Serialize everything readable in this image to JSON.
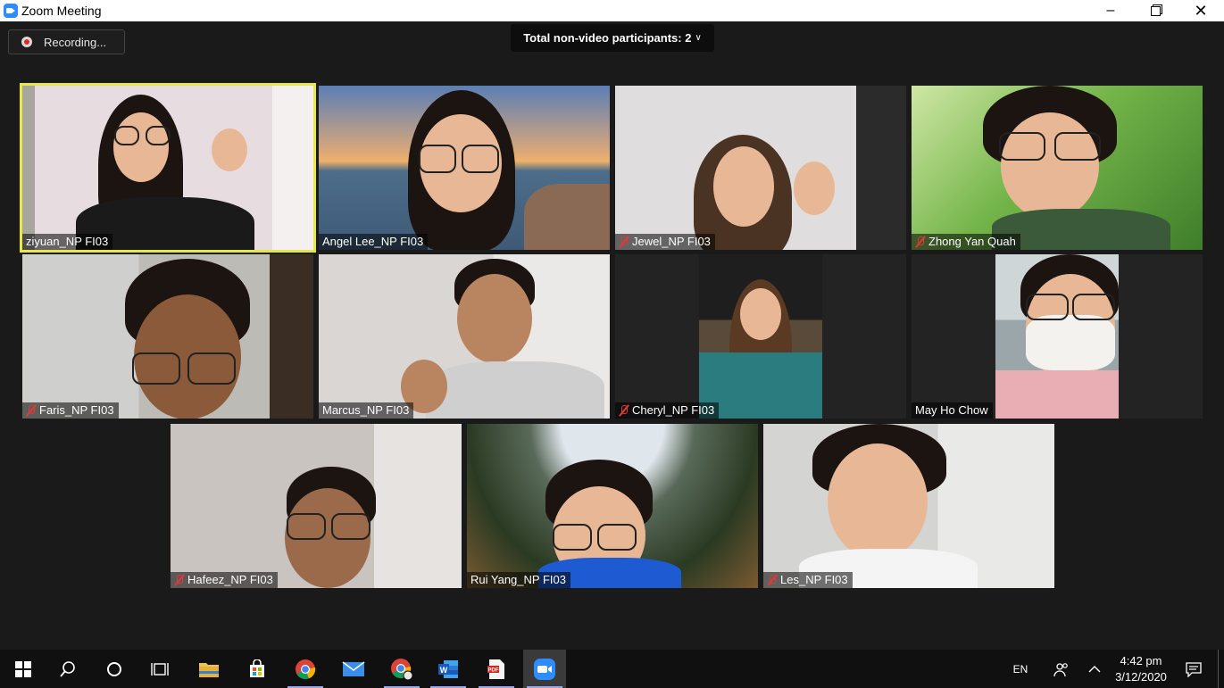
{
  "window": {
    "title": "Zoom Meeting"
  },
  "meeting": {
    "recording_label": "Recording...",
    "nonvideo_label": "Total non-video participants: 2"
  },
  "participants": [
    {
      "name": "ziyuan_NP FI03",
      "muted": false,
      "speaking": true
    },
    {
      "name": "Angel Lee_NP FI03",
      "muted": false
    },
    {
      "name": "Jewel_NP FI03",
      "muted": true
    },
    {
      "name": "Zhong Yan Quah",
      "muted": true
    },
    {
      "name": "Faris_NP FI03",
      "muted": true
    },
    {
      "name": "Marcus_NP FI03",
      "muted": false
    },
    {
      "name": "Cheryl_NP FI03",
      "muted": true
    },
    {
      "name": "May Ho Chow",
      "muted": false
    },
    {
      "name": "Hafeez_NP FI03",
      "muted": true
    },
    {
      "name": "Rui Yang_NP FI03",
      "muted": false
    },
    {
      "name": "Les_NP FI03",
      "muted": true
    }
  ],
  "taskbar": {
    "apps": [
      "windows-start",
      "search",
      "cortana",
      "task-view",
      "file-explorer",
      "microsoft-store",
      "chrome",
      "mail",
      "chrome-profile",
      "word",
      "acrobat",
      "zoom"
    ],
    "language": "EN",
    "time": "4:42 pm",
    "date": "3/12/2020"
  },
  "colors": {
    "active_speaker": "#e6e84a",
    "zoom_blue": "#2d8cff",
    "muted_red": "#e03838"
  }
}
